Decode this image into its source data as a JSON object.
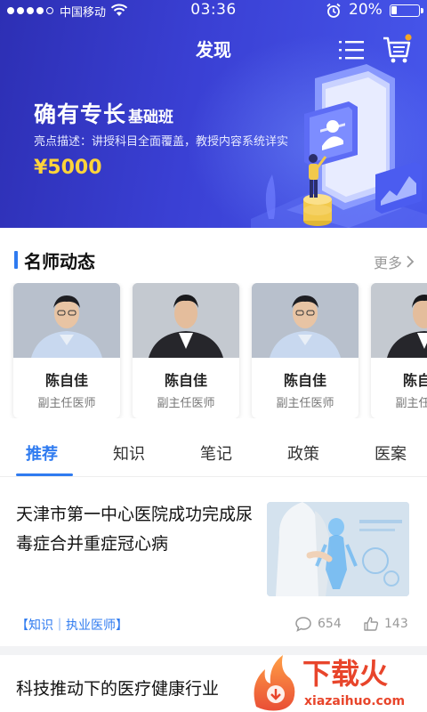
{
  "status": {
    "carrier": "中国移动",
    "time": "03:36",
    "battery_pct": "20%",
    "battery_level": 0.2,
    "signal_bars": 4
  },
  "nav": {
    "title": "发现"
  },
  "banner": {
    "title_main": "确有专长",
    "title_sub": "基础班",
    "description": "亮点描述：讲授科目全面覆盖，教授内容系统详实",
    "price": "¥5000"
  },
  "teachers_section": {
    "title": "名师动态",
    "more": "更多"
  },
  "teachers": [
    {
      "name": "陈自佳",
      "role": "副主任医师"
    },
    {
      "name": "陈自佳",
      "role": "副主任医师"
    },
    {
      "name": "陈自佳",
      "role": "副主任医师"
    },
    {
      "name": "陈自佳",
      "role": "副主任医师"
    }
  ],
  "tabs": [
    {
      "label": "推荐",
      "active": true
    },
    {
      "label": "知识"
    },
    {
      "label": "笔记"
    },
    {
      "label": "政策"
    },
    {
      "label": "医案"
    }
  ],
  "articles": [
    {
      "title": "天津市第一中心医院成功完成尿毒症合并重症冠心病",
      "tag": "【知识｜执业医师】",
      "comments": "654",
      "likes": "143"
    },
    {
      "title": "科技推动下的医疗健康行业"
    }
  ],
  "watermark": {
    "brand": "下载火",
    "url": "xiazaihuo.com"
  },
  "colors": {
    "accent": "#2f7bf0",
    "banner": "#3a40d4",
    "price": "#ffd43a",
    "watermark": "#e8452b"
  }
}
